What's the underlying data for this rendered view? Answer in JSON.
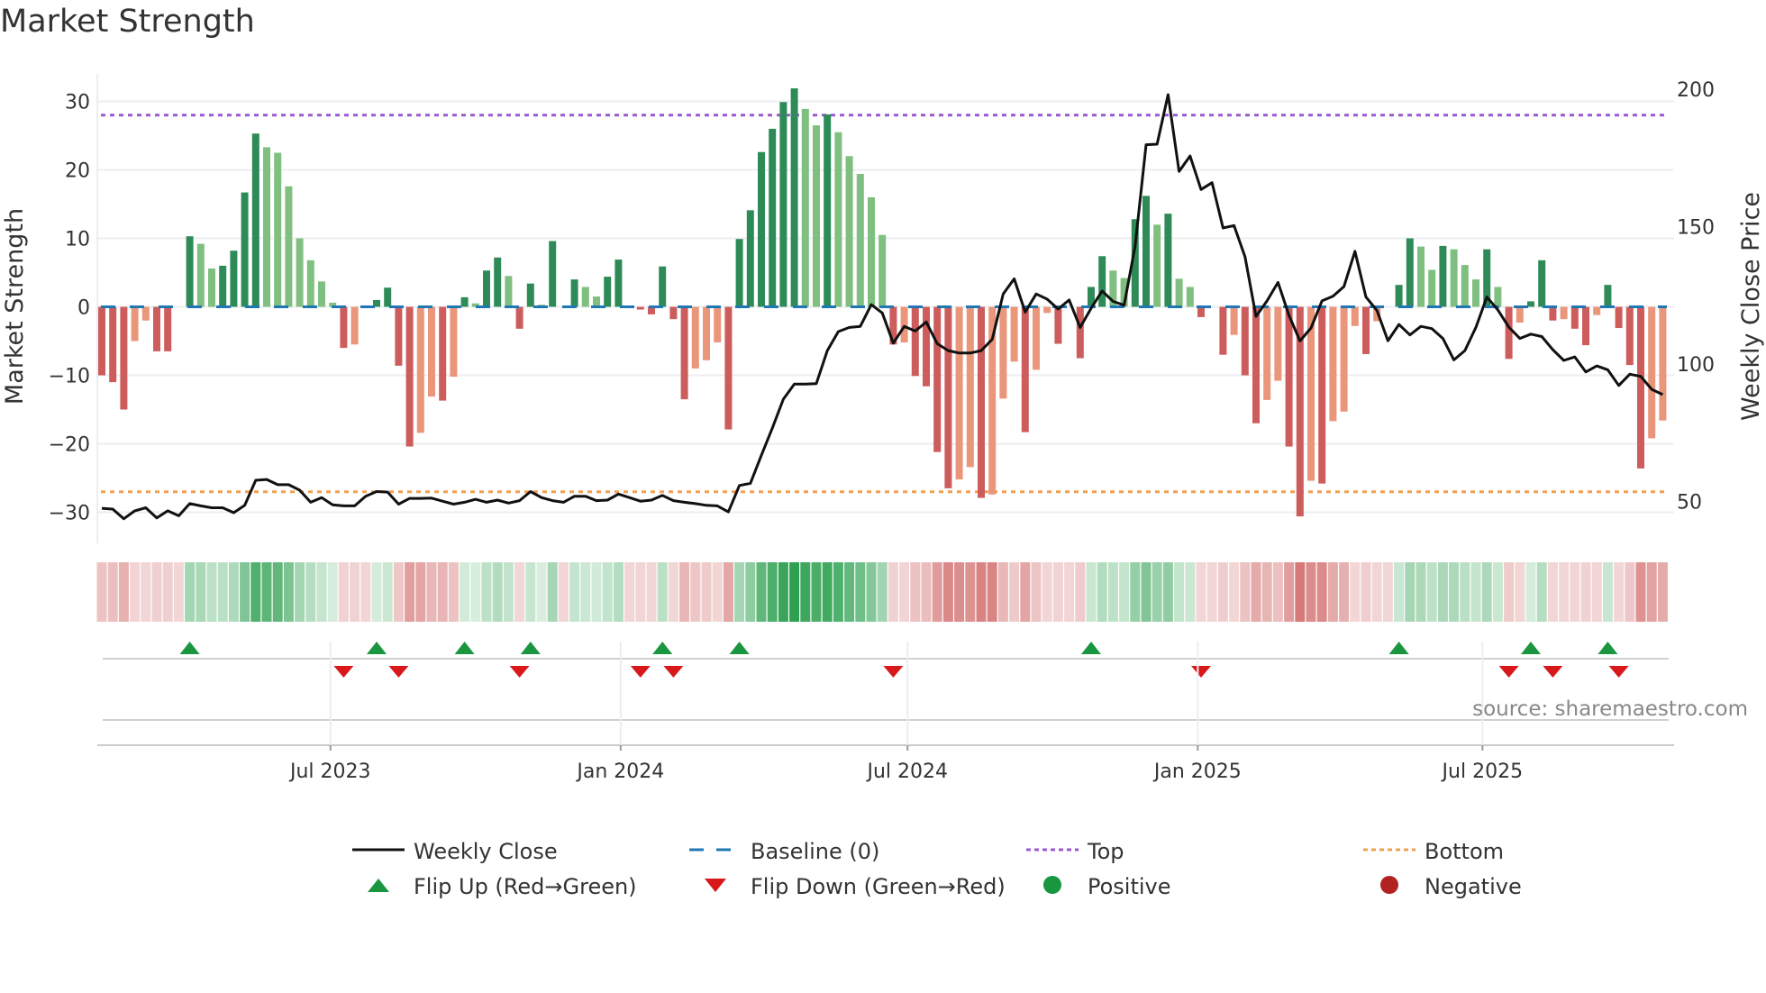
{
  "title": "Market Strength",
  "source": "source: sharemaestro.com",
  "colors": {
    "pos_rising": "#2e8b57",
    "pos_falling": "#7fbf7f",
    "neg_falling": "#cd5c5c",
    "neg_rising": "#e9967a",
    "line": "#111111",
    "baseline": "#1f77b4",
    "top": "#9b59d0",
    "bottom": "#f0a050",
    "flip_up": "#1a9641",
    "flip_down": "#d7191c",
    "positive": "#1a9641",
    "negative": "#b22222"
  },
  "legend": [
    {
      "label": "Weekly Close",
      "icon": "line-solid"
    },
    {
      "label": "Baseline (0)",
      "icon": "line-dashed"
    },
    {
      "label": "Top",
      "icon": "line-dotted-purple"
    },
    {
      "label": "Bottom",
      "icon": "line-dotted-orange"
    },
    {
      "label": "Flip Up (Red→Green)",
      "icon": "triangle-up"
    },
    {
      "label": "Flip Down (Green→Red)",
      "icon": "triangle-down"
    },
    {
      "label": "Positive",
      "icon": "circle-green"
    },
    {
      "label": "Negative",
      "icon": "circle-red"
    }
  ],
  "chart_data": {
    "type": "bar",
    "title": "Market Strength",
    "ylabel": "Market Strength",
    "y2label": "Weekly Close Price",
    "ylim": [
      -33,
      34
    ],
    "y2lim": [
      40,
      210
    ],
    "yticks": [
      -30,
      -20,
      -10,
      0,
      10,
      20,
      30
    ],
    "yticklabels": [
      "−30",
      "−20",
      "−10",
      "0",
      "10",
      "20",
      "30"
    ],
    "y2ticks": [
      50,
      100,
      150,
      200
    ],
    "y2ticklabels": [
      "50",
      "100",
      "150",
      "200"
    ],
    "top_level": 28,
    "bottom_level": -27,
    "baseline": 0,
    "x_unit": "week index",
    "xticks": [
      {
        "label": "Jul 2023",
        "week": 20.8
      },
      {
        "label": "Jan 2024",
        "week": 47.2
      },
      {
        "label": "Jul 2024",
        "week": 73.3
      },
      {
        "label": "Jan 2025",
        "week": 99.7
      },
      {
        "label": "Jul 2025",
        "week": 125.6
      }
    ],
    "strength": [
      -10,
      -11,
      -15,
      -5,
      -2,
      -6.5,
      -6.5,
      0,
      10.3,
      9.2,
      5.6,
      6,
      8.2,
      16.7,
      25.3,
      23.3,
      22.5,
      17.6,
      10,
      6.8,
      3.7,
      0.6,
      -6,
      -5.5,
      0,
      1,
      2.8,
      -8.6,
      -20.4,
      -18.4,
      -13.1,
      -13.7,
      -10.2,
      1.4,
      0.5,
      5.3,
      7.2,
      4.5,
      -3.2,
      3.4,
      0.3,
      9.6,
      0,
      4,
      2.9,
      1.5,
      4.4,
      6.9,
      0,
      -0.4,
      -1.1,
      5.9,
      -1.8,
      -13.5,
      -9,
      -7.8,
      -5.2,
      -17.9,
      9.9,
      14.1,
      22.6,
      26,
      29.9,
      31.9,
      28.9,
      26.5,
      28.1,
      25.5,
      22,
      19.4,
      16,
      10.5,
      -5.5,
      -5.2,
      -10.1,
      -11.6,
      -21.2,
      -26.5,
      -25.2,
      -23.4,
      -27.9,
      -27.4,
      -13.4,
      -8,
      -18.3,
      -9.2,
      -0.9,
      -5.4,
      0,
      -7.5,
      2.9,
      7.4,
      5.3,
      4.2,
      12.8,
      16.2,
      12,
      13.6,
      4.1,
      2.9,
      -1.5,
      0,
      -7,
      -4.1,
      -10,
      -17,
      -13.6,
      -10.8,
      -20.4,
      -30.6,
      -25.4,
      -25.8,
      -16.7,
      -15.3,
      -2.8,
      -6.9,
      -2.1,
      0,
      3.2,
      10,
      8.8,
      5.4,
      8.9,
      8.4,
      6.1,
      4,
      8.4,
      2.9,
      -7.6,
      -2.3,
      0.8,
      6.8,
      -2,
      -1.8,
      -3.2,
      -5.6,
      -1.2,
      3.2,
      -3.1,
      -8.5,
      -23.6,
      -19.2,
      -16.6
    ],
    "weekly_close": [
      47.5,
      47.2,
      43.7,
      46.6,
      47.7,
      44,
      46.6,
      44.8,
      49.2,
      48.4,
      47.7,
      47.7,
      45.9,
      48.6,
      57.7,
      58,
      56.1,
      56.1,
      54.1,
      49.7,
      51.4,
      48.8,
      48.4,
      48.4,
      51.9,
      53.6,
      53.4,
      49,
      51.1,
      51.1,
      51.2,
      50.1,
      49,
      49.7,
      50.8,
      49.7,
      50.5,
      49.4,
      50.3,
      53.6,
      51.4,
      50.3,
      49.7,
      51.9,
      51.9,
      50.3,
      50.5,
      52.7,
      51.4,
      50.1,
      50.5,
      52.2,
      50.3,
      49.7,
      49.2,
      48.6,
      48.4,
      46.2,
      55.8,
      56.6,
      66.8,
      76.7,
      87.2,
      92.7,
      92.7,
      92.9,
      104.9,
      111.8,
      113.3,
      113.7,
      121.6,
      118.6,
      107.6,
      113.7,
      112,
      115.3,
      107.4,
      104.9,
      104,
      104,
      104.9,
      109,
      125.5,
      131,
      118.9,
      125.5,
      123.6,
      120,
      123.3,
      113.3,
      120.3,
      126.6,
      122.8,
      121.4,
      142.9,
      179.8,
      180,
      198,
      170.1,
      175.7,
      163.5,
      166,
      149.5,
      150.4,
      139,
      117.3,
      123,
      129.7,
      117.7,
      108.4,
      113.1,
      123,
      124.7,
      128.2,
      141,
      124.4,
      119.5,
      108.5,
      114.4,
      110.6,
      113.7,
      112.9,
      109.3,
      101.5,
      104.9,
      113.3,
      124.4,
      119.7,
      113.4,
      109.3,
      110.9,
      110,
      105.2,
      101.3,
      102.6,
      97.1,
      99.3,
      97.9,
      92.2,
      96.3,
      95.5,
      90.8,
      88.9
    ],
    "flip_up_weeks": [
      8,
      25,
      33,
      39,
      51,
      58,
      90,
      118,
      130,
      137
    ],
    "flip_down_weeks": [
      22,
      27,
      38,
      49,
      52,
      72,
      100,
      128,
      132,
      138
    ]
  }
}
